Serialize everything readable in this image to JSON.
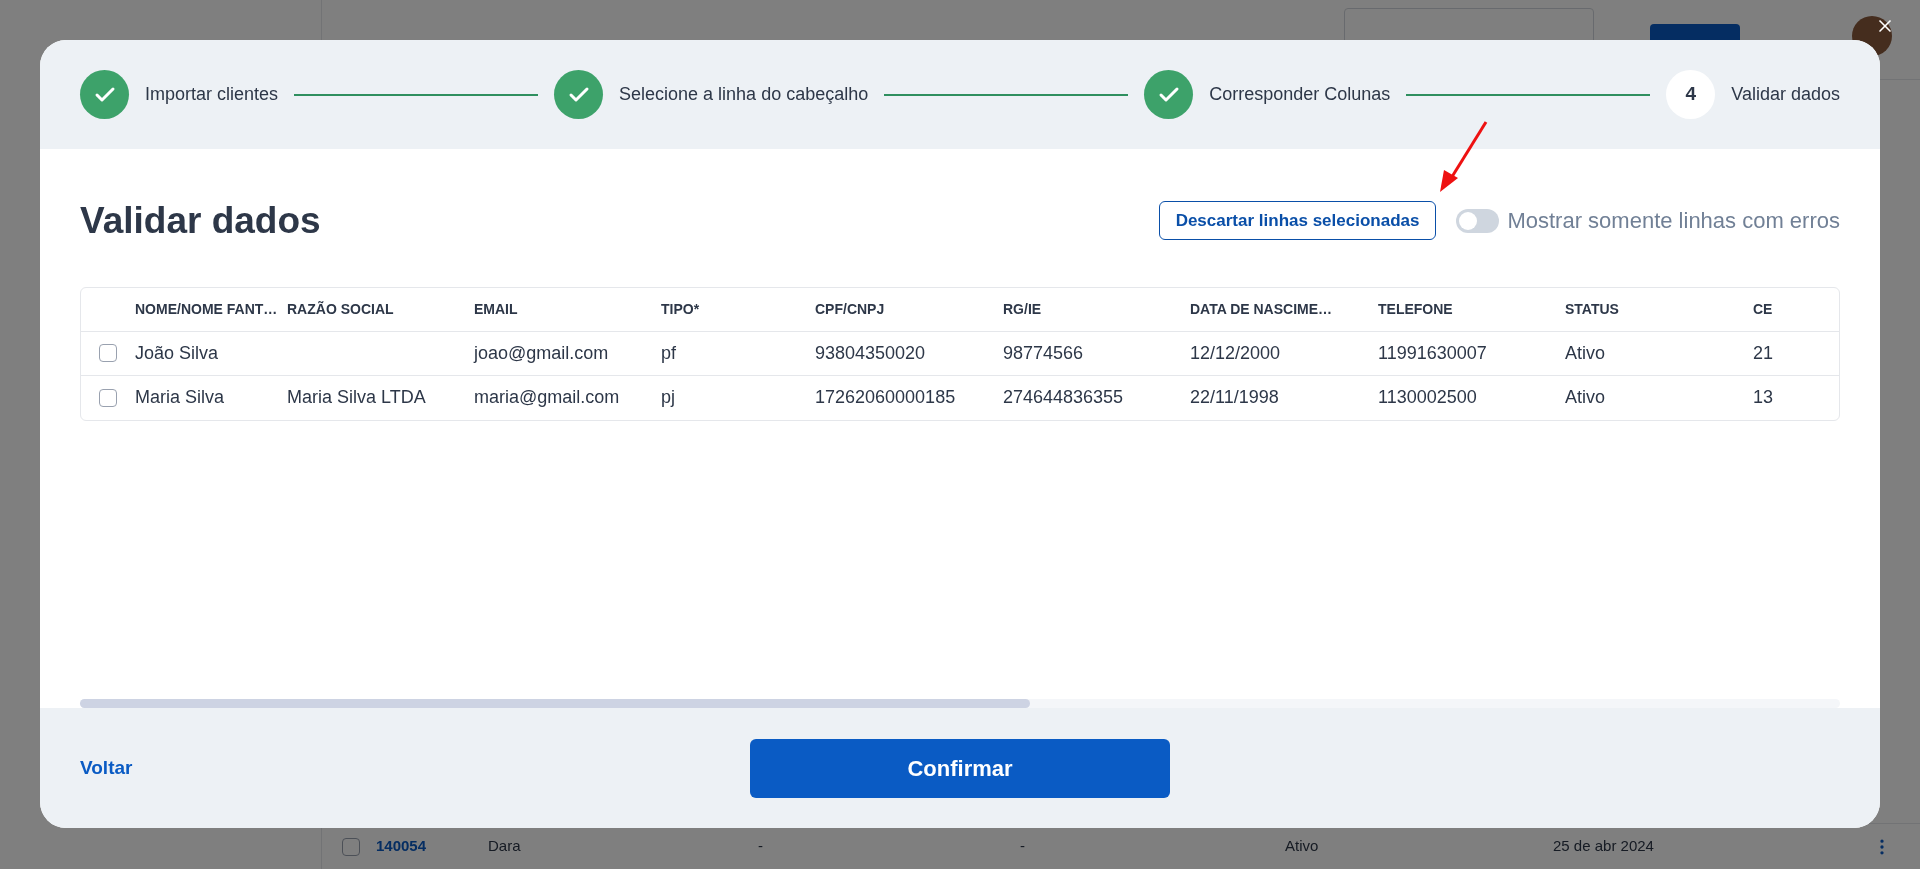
{
  "background": {
    "row": {
      "checked": false,
      "cells": [
        "140054",
        "Dara",
        "-",
        "-",
        "Ativo",
        "25 de abr 2024"
      ]
    }
  },
  "modal": {
    "steps": [
      {
        "label": "Importar clientes",
        "done": true
      },
      {
        "label": "Selecione a linha do cabeçalho",
        "done": true
      },
      {
        "label": "Corresponder Colunas",
        "done": true
      },
      {
        "label": "Validar dados",
        "done": false,
        "number": "4"
      }
    ],
    "title": "Validar dados",
    "discard_button": "Descartar linhas selecionadas",
    "toggle": {
      "label": "Mostrar somente linhas com erros",
      "on": false
    },
    "table": {
      "columns": [
        "NOME/NOME FANT…",
        "RAZÃO SOCIAL",
        "EMAIL",
        "TIPO*",
        "CPF/CNPJ",
        "RG/IE",
        "DATA DE NASCIME…",
        "TELEFONE",
        "STATUS",
        "CE"
      ],
      "rows": [
        {
          "checked": false,
          "cells": [
            "João Silva",
            "",
            "joao@gmail.com",
            "pf",
            "93804350020",
            "98774566",
            "12/12/2000",
            "11991630007",
            "Ativo",
            "21"
          ]
        },
        {
          "checked": false,
          "cells": [
            "Maria Silva",
            "Maria Silva LTDA",
            "maria@gmail.com",
            "pj",
            "17262060000185",
            "274644836355",
            "22/11/1998",
            "1130002500",
            "Ativo",
            "13"
          ]
        }
      ],
      "scroll": {
        "level": 0.54
      }
    },
    "back_link": "Voltar",
    "confirm_button": "Confirmar"
  }
}
